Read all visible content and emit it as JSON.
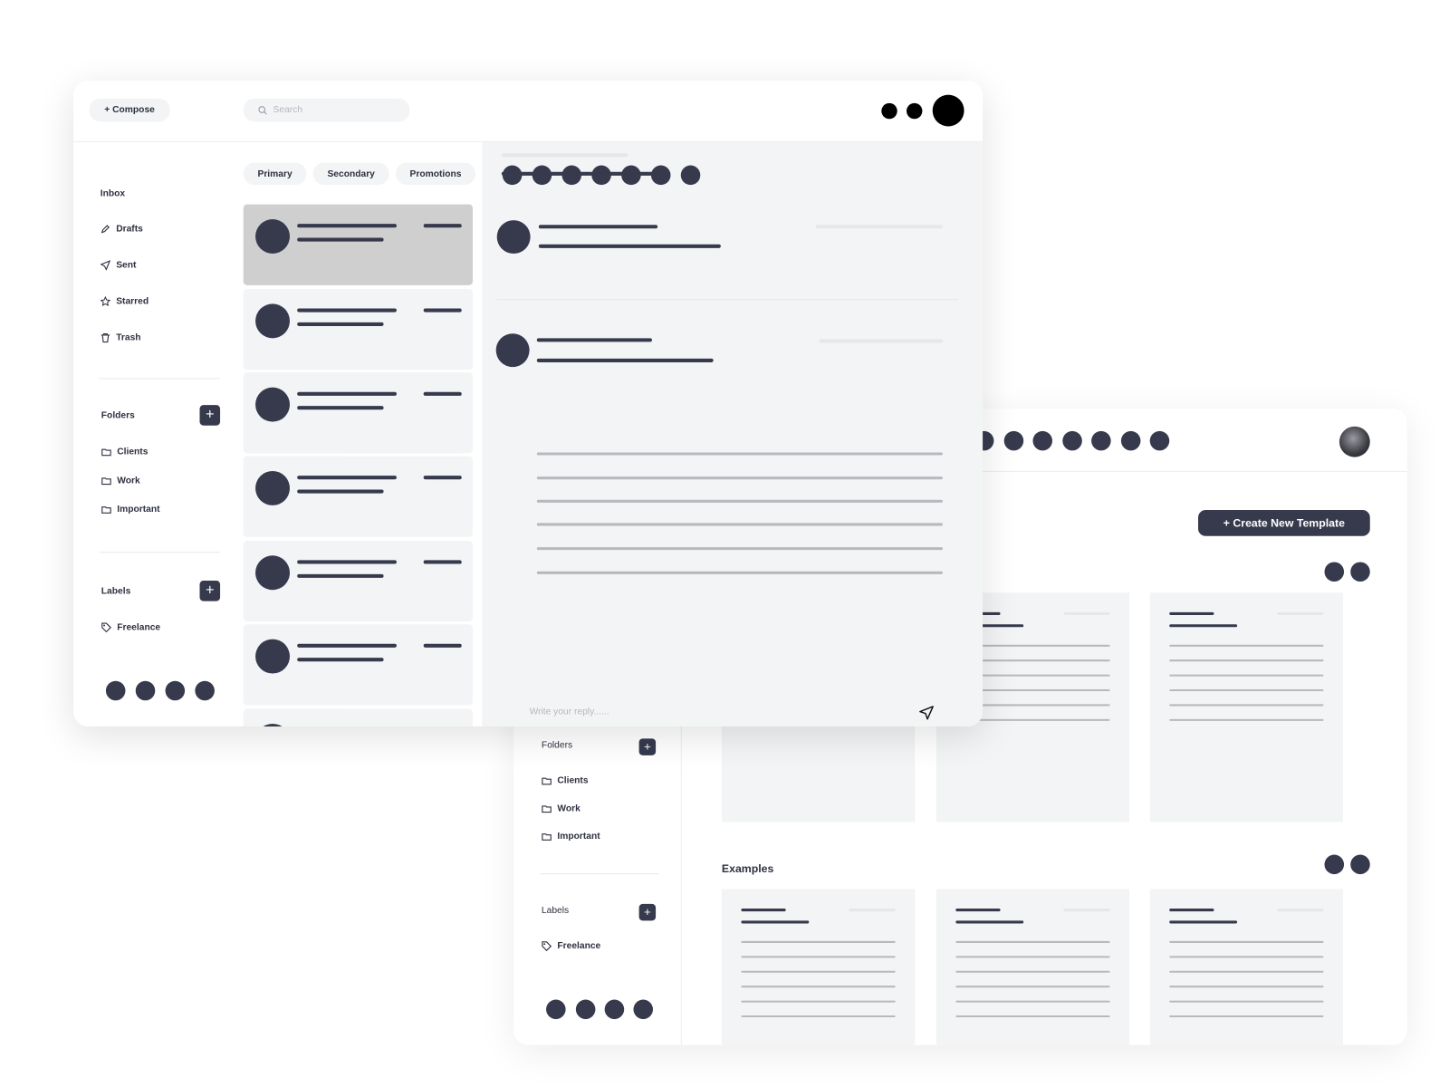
{
  "colors": {
    "accent": "#373a4d",
    "panel": "#f3f4f5",
    "selected": "#cfcfcf"
  },
  "front": {
    "compose_label": "+ Compose",
    "search_placeholder": "Search",
    "tabs": [
      {
        "label": "Primary"
      },
      {
        "label": "Secondary"
      },
      {
        "label": "Promotions"
      }
    ],
    "nav": [
      {
        "label": "Inbox",
        "icon": "inbox"
      },
      {
        "label": "Drafts",
        "icon": "pencil-icon"
      },
      {
        "label": "Sent",
        "icon": "send-icon"
      },
      {
        "label": "Starred",
        "icon": "star-icon"
      },
      {
        "label": "Trash",
        "icon": "trash-icon"
      }
    ],
    "folders_title": "Folders",
    "folders": [
      {
        "label": "Clients"
      },
      {
        "label": "Work"
      },
      {
        "label": "Important"
      }
    ],
    "labels_title": "Labels",
    "labels": [
      {
        "label": "Freelance"
      }
    ],
    "reply_placeholder": "Write your reply......"
  },
  "back": {
    "create_label": "+ Create New Template",
    "examples_title": "Examples",
    "folders_title": "Folders",
    "folders": [
      {
        "label": "Clients"
      },
      {
        "label": "Work"
      },
      {
        "label": "Important"
      }
    ],
    "labels_title": "Labels",
    "labels": [
      {
        "label": "Freelance"
      }
    ]
  }
}
